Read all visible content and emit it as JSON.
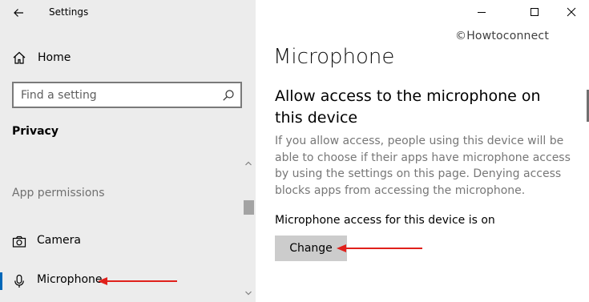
{
  "window": {
    "app_title": "Settings",
    "controls": [
      "minimize",
      "maximize",
      "close"
    ]
  },
  "sidebar": {
    "home_label": "Home",
    "search": {
      "placeholder": "Find a setting",
      "value": ""
    },
    "section_title": "Privacy",
    "group_label": "App permissions",
    "items": [
      {
        "label": "Camera",
        "icon": "camera-icon",
        "selected": false
      },
      {
        "label": "Microphone",
        "icon": "microphone-icon",
        "selected": true
      }
    ]
  },
  "watermark": "©Howtoconnect",
  "main": {
    "title": "Microphone",
    "heading": "Allow access to the microphone on this device",
    "description": "If you allow access, people using this device will be able to choose if their apps have microphone access by using the settings on this page. Denying access blocks apps from accessing the microphone.",
    "status": "Microphone access for this device is on",
    "change_button": "Change"
  },
  "colors": {
    "sidebar_bg": "#ececec",
    "accent": "#0067b8",
    "annotation_arrow": "#e0201b",
    "button_bg": "#cccccc"
  }
}
